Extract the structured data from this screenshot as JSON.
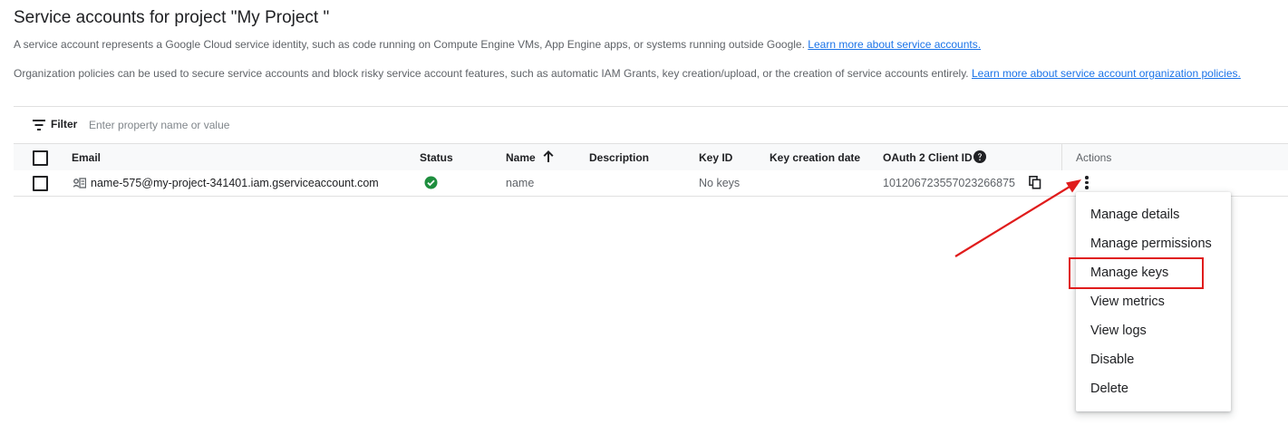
{
  "page": {
    "title": "Service accounts for project \"My Project \"",
    "description_1": "A service account represents a Google Cloud service identity, such as code running on Compute Engine VMs, App Engine apps, or systems running outside Google.",
    "description_1_link": "Learn more about service accounts.",
    "description_2": "Organization policies can be used to secure service accounts and block risky service account features, such as automatic IAM Grants, key creation/upload, or the creation of service accounts entirely.",
    "description_2_link": "Learn more about service account organization policies."
  },
  "filter": {
    "label": "Filter",
    "placeholder": "Enter property name or value",
    "icon": "filter-list-icon"
  },
  "table": {
    "columns": {
      "email": "Email",
      "status": "Status",
      "name": "Name",
      "description": "Description",
      "key_id": "Key ID",
      "key_creation_date": "Key creation date",
      "oauth_client_id": "OAuth 2 Client ID",
      "actions": "Actions"
    },
    "sort": {
      "column": "Name",
      "direction": "ascending",
      "icon": "arrow-upward-icon"
    },
    "rows": [
      {
        "email": "name-575@my-project-341401.iam.gserviceaccount.com",
        "status": "enabled",
        "status_icon": "check-circle-icon",
        "name": "name",
        "description": "",
        "key_id": "No keys",
        "key_creation_date": "",
        "oauth_client_id": "101206723557023266875"
      }
    ]
  },
  "actions_menu": {
    "items": [
      "Manage details",
      "Manage permissions",
      "Manage keys",
      "View metrics",
      "View logs",
      "Disable",
      "Delete"
    ],
    "highlighted": "Manage keys"
  },
  "colors": {
    "link": "#1a73e8",
    "status_green": "#1e8e3e",
    "annotation_red": "#e01c1c",
    "header_bg": "#f8f9fa",
    "border": "#e0e0e0"
  }
}
